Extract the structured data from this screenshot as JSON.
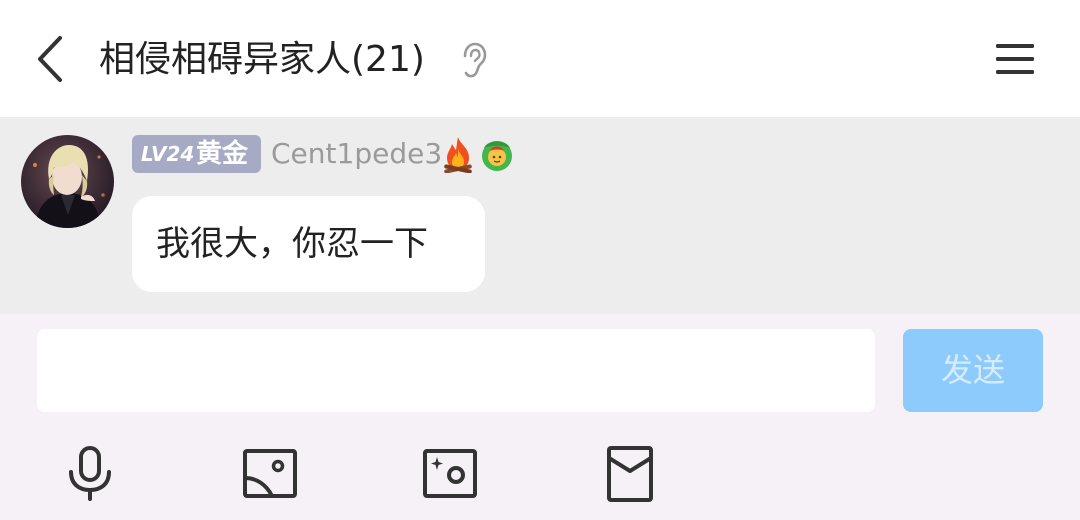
{
  "header": {
    "title": "相侵相碍异家人(21)",
    "back_icon": "chevron-left-icon",
    "ear_icon": "ear-icon",
    "menu_icon": "hamburger-menu-icon"
  },
  "message": {
    "level": "LV24",
    "rank": "黄金",
    "username": "Cent1pede3",
    "text": "我很大，你忍一下",
    "badges": [
      "fire-icon",
      "face-emoji-icon"
    ]
  },
  "composer": {
    "input_value": "",
    "send_label": "发送",
    "tools": [
      "microphone-icon",
      "image-icon",
      "sparkle-camera-icon",
      "red-envelope-icon"
    ]
  },
  "colors": {
    "header_bg": "#ffffff",
    "chat_bg": "#ededed",
    "composer_bg": "#f6f1f6",
    "level_badge": "#a7aac4",
    "send_button": "#8ccbfb",
    "username": "#9a9a9a"
  }
}
